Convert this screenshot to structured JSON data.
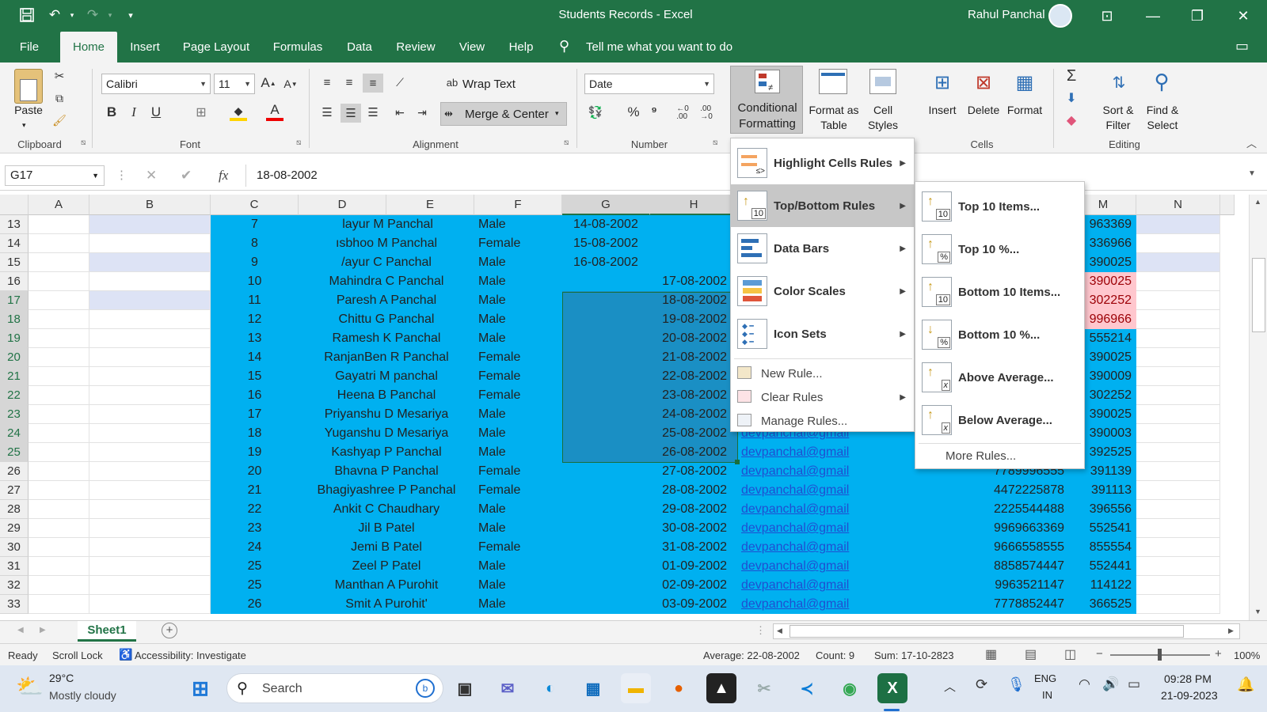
{
  "titlebar": {
    "title": "Students Records  -  Excel",
    "user": "Rahul Panchal",
    "save_icon": "save-icon",
    "undo_icon": "undo-icon",
    "redo_icon": "redo-icon"
  },
  "tabs": [
    {
      "label": "File"
    },
    {
      "label": "Home"
    },
    {
      "label": "Insert"
    },
    {
      "label": "Page Layout"
    },
    {
      "label": "Formulas"
    },
    {
      "label": "Data"
    },
    {
      "label": "Review"
    },
    {
      "label": "View"
    },
    {
      "label": "Help"
    }
  ],
  "tell_me": "Tell me what you want to do",
  "ribbon": {
    "clipboard": {
      "label": "Clipboard",
      "paste": "Paste"
    },
    "font": {
      "label": "Font",
      "name": "Calibri",
      "size": "11",
      "bold": "B",
      "italic": "I",
      "underline": "U"
    },
    "alignment": {
      "label": "Alignment",
      "wrap": "Wrap Text",
      "merge": "Merge & Center"
    },
    "number": {
      "label": "Number",
      "format": "Date",
      "percent": "%",
      "comma": "⁹"
    },
    "styles": {
      "cond_format_1": "Conditional",
      "cond_format_2": "Formatting",
      "format_table_1": "Format as",
      "format_table_2": "Table",
      "cell_styles_1": "Cell",
      "cell_styles_2": "Styles"
    },
    "cells": {
      "label": "Cells",
      "insert": "Insert",
      "delete": "Delete",
      "format": "Format"
    },
    "editing": {
      "label": "Editing",
      "sort_1": "Sort &",
      "sort_2": "Filter",
      "find_1": "Find &",
      "find_2": "Select"
    }
  },
  "formula_bar": {
    "name_box": "G17",
    "fx": "fx",
    "value": "18-08-2002"
  },
  "columns": [
    "A",
    "B",
    "C",
    "D",
    "E",
    "F",
    "G",
    "H",
    "M",
    "N"
  ],
  "rows": [
    {
      "num": "13",
      "c": "7",
      "name": " layur M Panchal",
      "gender": "Male",
      "date": "14-08-2002",
      "email": "",
      "phone": "",
      "m": "963369"
    },
    {
      "num": "14",
      "c": "8",
      "name": "ısbhoo M Panchal",
      "gender": "Female",
      "date": "15-08-2002",
      "email": "",
      "phone": "",
      "m": "336966"
    },
    {
      "num": "15",
      "c": "9",
      "name": "/ayur C Panchal",
      "gender": "Male",
      "date": "16-08-2002",
      "email": "",
      "phone": "",
      "m": "390025"
    },
    {
      "num": "16",
      "c": "10",
      "name": "Mahindra C Panchal",
      "gender": "Male",
      "date": "17-08-2002",
      "email": "",
      "phone": "",
      "m": "390025"
    },
    {
      "num": "17",
      "c": "11",
      "name": "Paresh A Panchal",
      "gender": "Male",
      "date": "18-08-2002",
      "email": "",
      "phone": "",
      "m": "302252"
    },
    {
      "num": "18",
      "c": "12",
      "name": "Chittu G Panchal",
      "gender": "Male",
      "date": "19-08-2002",
      "email": "",
      "phone": "",
      "m": "996966"
    },
    {
      "num": "19",
      "c": "13",
      "name": "Ramesh K Panchal",
      "gender": "Male",
      "date": "20-08-2002",
      "email": "",
      "phone": "",
      "m": "555214"
    },
    {
      "num": "20",
      "c": "14",
      "name": "RanjanBen R Panchal",
      "gender": "Female",
      "date": "21-08-2002",
      "email": "",
      "phone": "",
      "m": "390025"
    },
    {
      "num": "21",
      "c": "15",
      "name": "Gayatri M panchal",
      "gender": "Female",
      "date": "22-08-2002",
      "email": "",
      "phone": "",
      "m": "390009"
    },
    {
      "num": "22",
      "c": "16",
      "name": "Heena B Panchal",
      "gender": "Female",
      "date": "23-08-2002",
      "email": "",
      "phone": "",
      "m": "302252"
    },
    {
      "num": "23",
      "c": "17",
      "name": "Priyanshu D Mesariya",
      "gender": "Male",
      "date": "24-08-2002",
      "email": "",
      "phone": "",
      "m": "390025"
    },
    {
      "num": "24",
      "c": "18",
      "name": "Yuganshu D Mesariya",
      "gender": "Male",
      "date": "25-08-2002",
      "email": "devpanchal@gmail",
      "phone": "",
      "m": "390003"
    },
    {
      "num": "25",
      "c": "19",
      "name": "Kashyap P Panchal",
      "gender": "Male",
      "date": "26-08-2002",
      "email": "devpanchal@gmail",
      "phone": "",
      "m": "392525"
    },
    {
      "num": "26",
      "c": "20",
      "name": "Bhavna P Panchal",
      "gender": "Female",
      "date": "27-08-2002",
      "email": "devpanchal@gmail",
      "phone": "7789996555",
      "m": "391139"
    },
    {
      "num": "27",
      "c": "21",
      "name": "Bhagiyashree P Panchal",
      "gender": "Female",
      "date": "28-08-2002",
      "email": "devpanchal@gmail",
      "phone": "4472225878",
      "m": "391113"
    },
    {
      "num": "28",
      "c": "22",
      "name": "Ankit C Chaudhary",
      "gender": "Male",
      "date": "29-08-2002",
      "email": "devpanchal@gmail",
      "phone": "2225544488",
      "m": "396556"
    },
    {
      "num": "29",
      "c": "23",
      "name": "Jil B Patel",
      "gender": "Male",
      "date": "30-08-2002",
      "email": "devpanchal@gmail",
      "phone": "9969663369",
      "m": "552541"
    },
    {
      "num": "30",
      "c": "24",
      "name": "Jemi B Patel",
      "gender": "Female",
      "date": "31-08-2002",
      "email": "devpanchal@gmail",
      "phone": "9666558555",
      "m": "855554"
    },
    {
      "num": "31",
      "c": "25",
      "name": "Zeel P Patel",
      "gender": "Male",
      "date": "01-09-2002",
      "email": "devpanchal@gmail",
      "phone": "8858574447",
      "m": "552441"
    },
    {
      "num": "32",
      "c": "25",
      "name": "Manthan A Purohit",
      "gender": "Male",
      "date": "02-09-2002",
      "email": "devpanchal@gmail",
      "phone": "9963521147",
      "m": "114122"
    },
    {
      "num": "33",
      "c": "26",
      "name": "Smit A Purohit'",
      "gender": "Male",
      "date": "03-09-2002",
      "email": "devpanchal@gmail",
      "phone": "7778852447",
      "m": "366525"
    }
  ],
  "cf_menu": [
    {
      "label": "Highlight Cells Rules",
      "icon": "highlight-cells-icon"
    },
    {
      "label": "Top/Bottom Rules",
      "icon": "top-bottom-icon"
    },
    {
      "label": "Data Bars",
      "icon": "data-bars-icon"
    },
    {
      "label": "Color Scales",
      "icon": "color-scales-icon"
    },
    {
      "label": "Icon Sets",
      "icon": "icon-sets-icon"
    }
  ],
  "cf_small": [
    {
      "label": "New Rule..."
    },
    {
      "label": "Clear Rules"
    },
    {
      "label": "Manage Rules..."
    }
  ],
  "submenu": [
    {
      "label": "Top 10 Items...",
      "badge": "10"
    },
    {
      "label": "Top 10 %...",
      "badge": "%"
    },
    {
      "label": "Bottom 10 Items...",
      "badge": "10"
    },
    {
      "label": "Bottom 10 %...",
      "badge": "%"
    },
    {
      "label": "Above Average...",
      "badge": "x"
    },
    {
      "label": "Below Average...",
      "badge": "x"
    }
  ],
  "more_rules": "More Rules...",
  "sheet_tab": "Sheet1",
  "status": {
    "ready": "Ready",
    "scroll_lock": "Scroll Lock",
    "accessibility": "Accessibility: Investigate",
    "average": "Average: 22-08-2002",
    "count": "Count: 9",
    "sum": "Sum: 17-10-2823",
    "zoom": "100%"
  },
  "taskbar": {
    "temp": "29°C",
    "weather": "Mostly cloudy",
    "search": "Search",
    "lang_1": "ENG",
    "lang_2": "IN",
    "time": "09:28 PM",
    "date": "21-09-2023"
  },
  "colors": {
    "accent": "#217346",
    "cell_blue": "#00b0f0",
    "selected": "#1a8fc4",
    "pink": "#ffc7ce"
  }
}
